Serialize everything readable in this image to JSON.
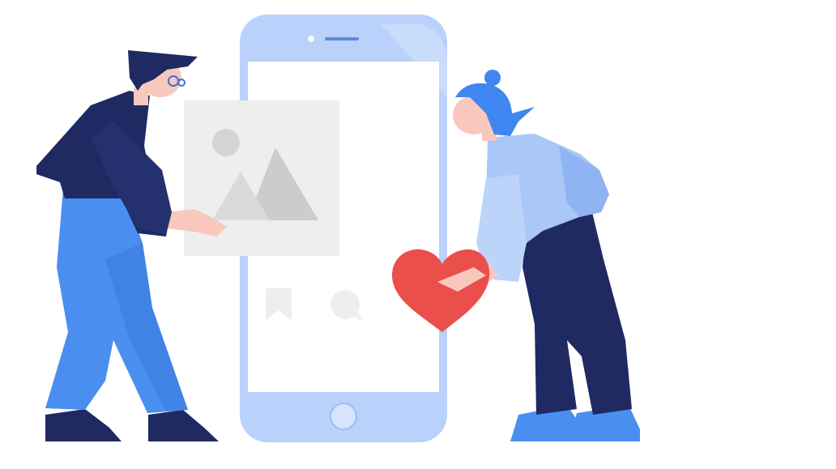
{
  "illustration": {
    "subject": "two-people-sharing-content-via-phone",
    "elements": {
      "phone": "smartphone",
      "photo": "image-placeholder",
      "bookmark": "bookmark-icon",
      "comment": "comment-icon",
      "heart": "heart",
      "man": "man-holding-photo",
      "woman": "woman-holding-heart"
    },
    "colors": {
      "phone_body": "#b9d1fb",
      "phone_screen": "#ffffff",
      "photo_bg": "#eeeeee",
      "photo_glyph": "#d1d1d1",
      "heart": "#eb4f4c",
      "navy": "#1f2a63",
      "blue": "#4a8ff0",
      "light_blue": "#a9c7f7",
      "skin": "#f9c8bd"
    }
  }
}
